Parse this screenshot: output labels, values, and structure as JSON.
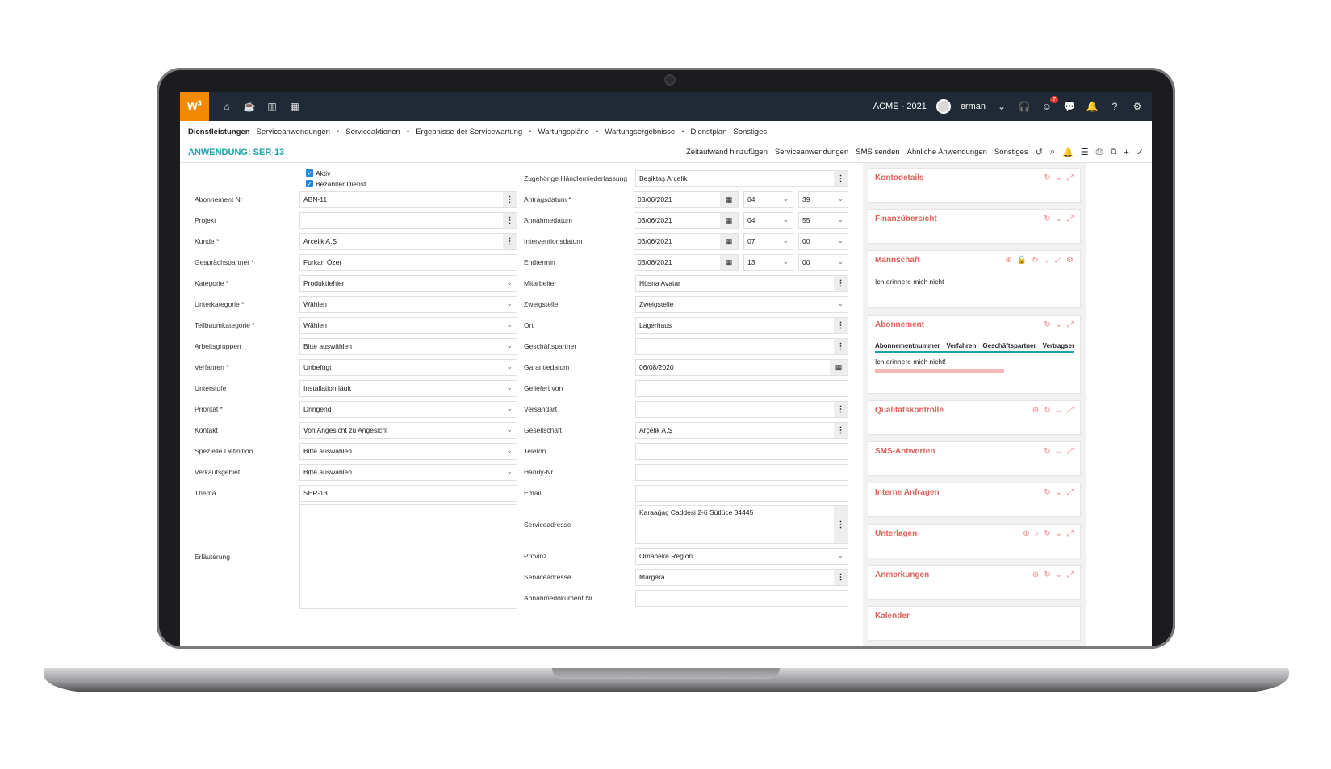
{
  "topbar": {
    "logo": "w³",
    "company": "ACME - 2021",
    "user": "erman",
    "notif_count": "7",
    "nav_icons": [
      "home-icon",
      "coffee-icon",
      "chart-icon",
      "calendar-icon"
    ]
  },
  "menu": {
    "items": [
      "Dienstleistungen",
      "Serviceanwendungen",
      "Serviceaktionen",
      "Ergebnisse der Servicewartung",
      "Wartungspläne",
      "Wartungsergebnisse",
      "Dienstplan",
      "Sonstiges"
    ]
  },
  "title": "ANWENDUNG: SER-13",
  "actions": [
    "Zeitaufwand hinzufügen",
    "Serviceanwendungen",
    "SMS senden",
    "Ähnliche Anwendungen",
    "Sonstiges"
  ],
  "checks": [
    "Aktiv",
    "Bezahlter Dienst"
  ],
  "left": [
    {
      "label": "Abonnement Nr",
      "value": "ABN-11",
      "type": "dots"
    },
    {
      "label": "Projekt",
      "value": "",
      "type": "dots"
    },
    {
      "label": "Kunde *",
      "value": "Arçelik A.Ş",
      "type": "dots"
    },
    {
      "label": "Gesprächspartner *",
      "value": "Furkan Özer",
      "type": "text"
    },
    {
      "label": "Kategorie *",
      "value": "Produktfehler",
      "type": "select"
    },
    {
      "label": "Unterkategorie *",
      "value": "Wählen",
      "type": "select"
    },
    {
      "label": "Teilbaumkategorie *",
      "value": "Wählen",
      "type": "select"
    },
    {
      "label": "Arbeitsgruppen",
      "value": "Bitte auswählen",
      "type": "select"
    },
    {
      "label": "Verfahren *",
      "value": "Unbefugt",
      "type": "select"
    },
    {
      "label": "Unterstufe",
      "value": "Installation läuft",
      "type": "select"
    },
    {
      "label": "Priorität *",
      "value": "Dringend",
      "type": "select"
    },
    {
      "label": "Kontakt",
      "value": "Von Angesicht zu Angesicht",
      "type": "select"
    },
    {
      "label": "Spezielle Definition",
      "value": "Bitte auswählen",
      "type": "select"
    },
    {
      "label": "Verkaufsgebiet",
      "value": "Bitte auswählen",
      "type": "select"
    },
    {
      "label": "Thema",
      "value": "SER-13",
      "type": "text"
    }
  ],
  "erlauterung": "Erläuterung",
  "right": {
    "haendler": {
      "label": "Zugehörige Händlerniederlassung",
      "value": "Beşiktaş Arçelik"
    },
    "dates": [
      {
        "label": "Antragsdatum *",
        "date": "03/06/2021",
        "h": "04",
        "m": "39"
      },
      {
        "label": "Annahmedatum",
        "date": "03/06/2021",
        "h": "04",
        "m": "55"
      },
      {
        "label": "Interventionsdatum",
        "date": "03/06/2021",
        "h": "07",
        "m": "00"
      },
      {
        "label": "Endtermin",
        "date": "03/06/2021",
        "h": "13",
        "m": "00"
      }
    ],
    "fields": [
      {
        "label": "Mitarbeiter",
        "value": "Hüsna Avatar",
        "type": "dots"
      },
      {
        "label": "Zweigstelle",
        "value": "Zweigstelle",
        "type": "select"
      },
      {
        "label": "Ort",
        "value": "Lagerhaus",
        "type": "dots"
      },
      {
        "label": "Geschäftspartner",
        "value": "",
        "type": "dots"
      },
      {
        "label": "Garantiedatum",
        "value": "06/08/2020",
        "type": "cal"
      },
      {
        "label": "Geliefert von",
        "value": "",
        "type": "text"
      },
      {
        "label": "Versandart",
        "value": "",
        "type": "dots"
      },
      {
        "label": "Gesellschaft",
        "value": "Arçelik A.Ş",
        "type": "dots"
      },
      {
        "label": "Telefon",
        "value": "",
        "type": "text"
      },
      {
        "label": "Handy-Nr.",
        "value": "",
        "type": "text"
      },
      {
        "label": "Email",
        "value": "",
        "type": "text"
      }
    ],
    "address": {
      "label": "Serviceadresse",
      "value": "Karaağaç Caddesi 2-6 Sütlüce 34445"
    },
    "fields2": [
      {
        "label": "Provinz",
        "value": "Omaheke Region",
        "type": "select"
      },
      {
        "label": "Serviceadresse",
        "value": "Margara",
        "type": "dots"
      },
      {
        "label": "Abnahmedokument Nr.",
        "value": "",
        "type": "text"
      }
    ]
  },
  "panels": {
    "kontodetails": "Kontodetails",
    "finanz": "Finanzübersicht",
    "mannschaft": "Mannschaft",
    "mannschaft_body": "Ich erinnere mich nicht",
    "abonnement": "Abonnement",
    "abo_tabs": [
      "Abonnementnummer",
      "Verfahren",
      "Geschäftspartner",
      "Vertragsende"
    ],
    "abo_body": "Ich erinnere mich nicht!",
    "qualitaet": "Qualitätskontrolle",
    "sms": "SMS-Antworten",
    "anfragen": "Interne Anfragen",
    "unterlagen": "Unterlagen",
    "anmerkungen": "Anmerkungen",
    "kalender": "Kalender"
  }
}
